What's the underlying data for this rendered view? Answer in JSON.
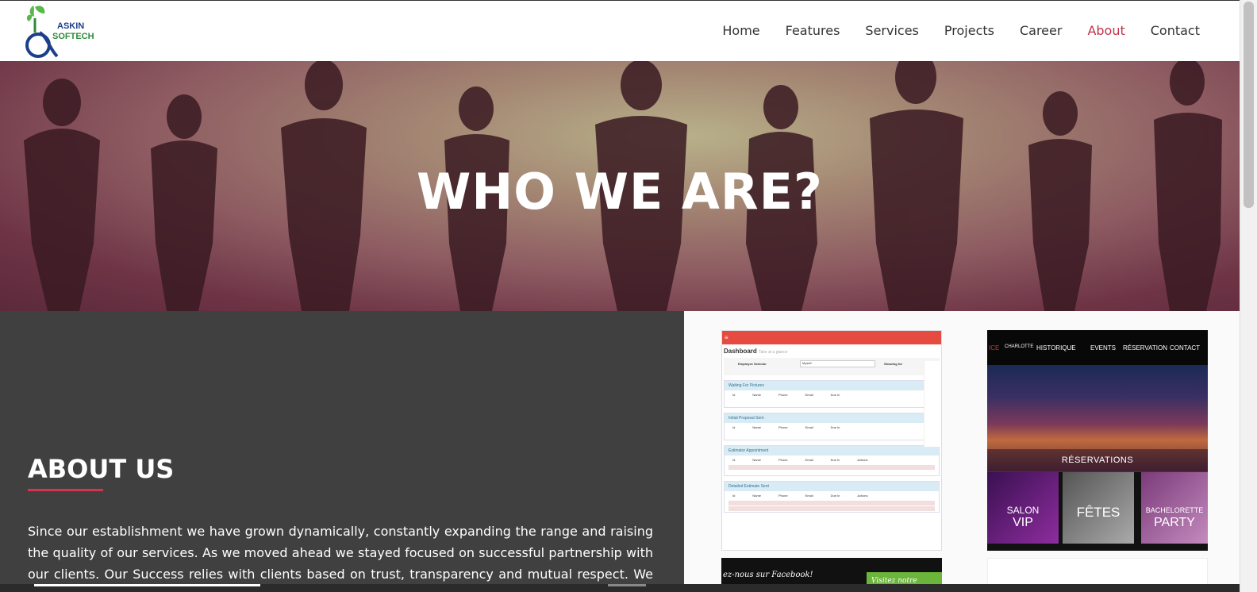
{
  "brand": {
    "line1": "ASKIN",
    "line2": "SOFTECH",
    "colors": {
      "blue": "#1c3f8a",
      "green": "#2e8b3c",
      "leaf": "#57b947"
    }
  },
  "nav": {
    "items": [
      {
        "label": "Home",
        "active": false
      },
      {
        "label": "Features",
        "active": false
      },
      {
        "label": "Services",
        "active": false
      },
      {
        "label": "Projects",
        "active": false
      },
      {
        "label": "Career",
        "active": false
      },
      {
        "label": "About",
        "active": true
      },
      {
        "label": "Contact",
        "active": false
      }
    ],
    "active_color": "#c2334d"
  },
  "hero": {
    "title": "WHO WE ARE?"
  },
  "about": {
    "title": "ABOUT US",
    "accent": "#d6334f",
    "text": "Since our establishment we have grown dynamically, constantly expanding the range and raising the quality of our services. As we moved ahead we stayed focused on successful partnership with our clients. Our Success relies with clients based on trust, transparency and mutual respect. We endeavor to work so"
  },
  "gallery": {
    "dashboard": {
      "title": "Dashboard",
      "subtitle": "Take at a glance",
      "employee_selector": "Employee Selector",
      "selector_value": "Myself",
      "showing_for": "Showing for",
      "panels": [
        "Waiting For Pictures",
        "Initial Proposal Sent",
        "Estimator Appointment",
        "Detailed Estimate Sent"
      ],
      "cols": [
        "Id",
        "Name",
        "Phone",
        "Email",
        "Due In"
      ],
      "actions": "Actions"
    },
    "club": {
      "logo_left": "ICE",
      "logo_right": "CHARLOTTE",
      "menu": [
        "HISTORIQUE",
        "EVENTS",
        "RÉSERVATION",
        "CONTACT"
      ],
      "banner": "RÉSERVATIONS",
      "tiles": [
        {
          "a": "SALON",
          "b": "VIP"
        },
        {
          "a": "FÊTES",
          "b": ""
        },
        {
          "a": "BACHELORETTE",
          "b": "PARTY"
        }
      ]
    },
    "facebook": {
      "left": "ez-nous sur Facebook!",
      "right": "Visitez notre Boutique en"
    }
  }
}
